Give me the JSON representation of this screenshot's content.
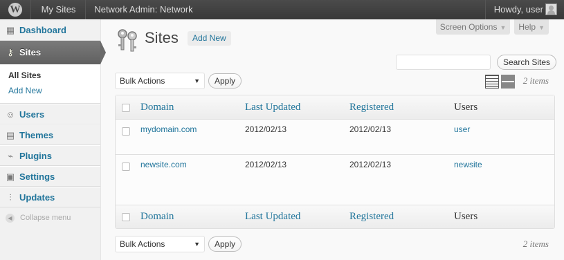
{
  "admin_bar": {
    "wp_logo": "W",
    "my_sites": "My Sites",
    "network_admin": "Network Admin: Network",
    "howdy": "Howdy, user"
  },
  "sidebar": {
    "items": [
      {
        "label": "Dashboard",
        "icon": "dashboard-icon"
      },
      {
        "label": "Sites",
        "icon": "sites-icon"
      },
      {
        "label": "Users",
        "icon": "users-icon"
      },
      {
        "label": "Themes",
        "icon": "themes-icon"
      },
      {
        "label": "Plugins",
        "icon": "plugins-icon"
      },
      {
        "label": "Settings",
        "icon": "settings-icon"
      },
      {
        "label": "Updates",
        "icon": "updates-icon"
      }
    ],
    "submenu": [
      "All Sites",
      "Add New"
    ],
    "collapse": "Collapse menu"
  },
  "screen_meta": {
    "screen_options": "Screen Options",
    "help": "Help"
  },
  "page": {
    "title": "Sites",
    "add_new": "Add New"
  },
  "search": {
    "value": "",
    "button": "Search Sites"
  },
  "bulk": {
    "selected": "Bulk Actions",
    "apply": "Apply"
  },
  "count": "2 items",
  "table": {
    "columns": [
      "Domain",
      "Last Updated",
      "Registered",
      "Users"
    ],
    "rows": [
      {
        "domain": "mydomain.com",
        "updated": "2012/02/13",
        "registered": "2012/02/13",
        "users": "user"
      },
      {
        "domain": "newsite.com",
        "updated": "2012/02/13",
        "registered": "2012/02/13",
        "users": "newsite"
      }
    ]
  },
  "colors": {
    "admin_bar": "#464646",
    "link": "#21759b",
    "active_menu": "#6d6d6d"
  }
}
